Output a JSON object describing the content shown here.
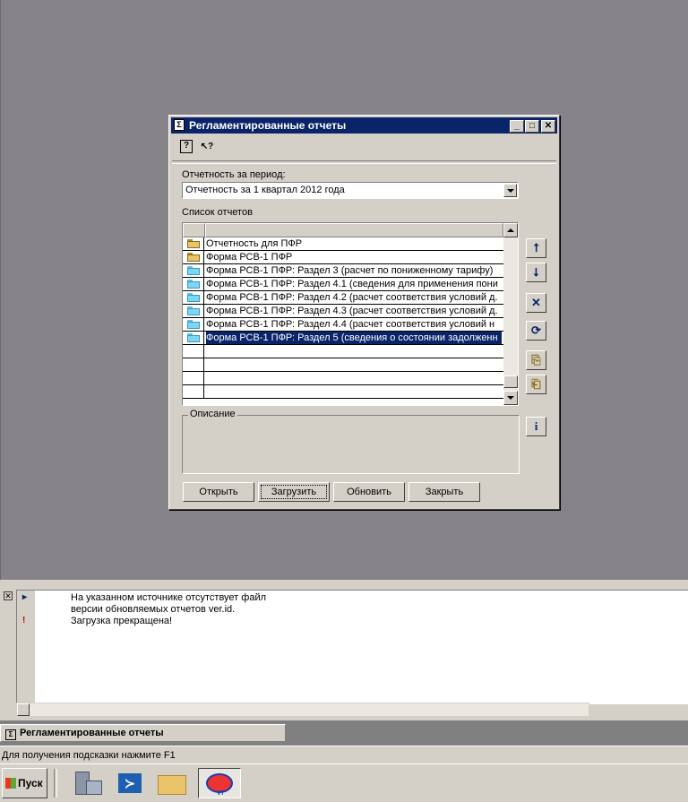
{
  "dialog": {
    "title": "Регламентированные отчеты",
    "period_label": "Отчетность за период:",
    "period_value": "Отчетность за 1 квартал 2012 года",
    "list_label": "Список отчетов",
    "reports": [
      {
        "label": "Отчетность для ПФР",
        "icon": "folder-open-icon",
        "selected": false
      },
      {
        "label": "Форма РСВ-1 ПФР",
        "icon": "folder-open-icon",
        "selected": false
      },
      {
        "label": "Форма РСВ-1 ПФР: Раздел 3 (расчет по пониженному тарифу)",
        "icon": "folder-icon",
        "selected": false
      },
      {
        "label": "Форма РСВ-1 ПФР: Раздел 4.1 (сведения для применения пони",
        "icon": "folder-icon",
        "selected": false
      },
      {
        "label": "Форма РСВ-1 ПФР: Раздел 4.2 (расчет соответствия условий д.",
        "icon": "folder-icon",
        "selected": false
      },
      {
        "label": "Форма РСВ-1 ПФР: Раздел 4.3 (расчет соответствия условий д.",
        "icon": "folder-icon",
        "selected": false
      },
      {
        "label": "Форма РСВ-1 ПФР: Раздел 4.4 (расчет соответствия условий н",
        "icon": "folder-icon",
        "selected": false
      },
      {
        "label": "Форма РСВ-1 ПФР: Раздел 5 (сведения о состоянии задолженн",
        "icon": "folder-icon",
        "selected": true
      }
    ],
    "description_label": "Описание",
    "buttons": {
      "open": "Открыть",
      "load": "Загрузить",
      "update": "Обновить",
      "close": "Закрыть"
    },
    "toolbar": {
      "help_icon": "?",
      "pointer_help_icon": "↖?"
    },
    "side_buttons": {
      "up": "⭡",
      "down": "⭣",
      "delete": "✕",
      "refresh": "⟳",
      "load_file": "⎘",
      "save_file": "⎗",
      "info": "i"
    },
    "colors": {
      "title_bar": "#0a246a",
      "selection": "#0a246a",
      "face": "#d4d0c8"
    }
  },
  "messages": [
    {
      "icon": "▸",
      "text": "На указанном источнике отсутствует файл"
    },
    {
      "icon": "",
      "text": "версии обновляемых отчетов ver.id."
    },
    {
      "icon": "!",
      "text": "Загрузка прекращена!"
    }
  ],
  "window_tab": "Регламентированные отчеты",
  "status_text": "Для получения подсказки нажмите F1",
  "taskbar": {
    "start_label": "Пуск"
  }
}
